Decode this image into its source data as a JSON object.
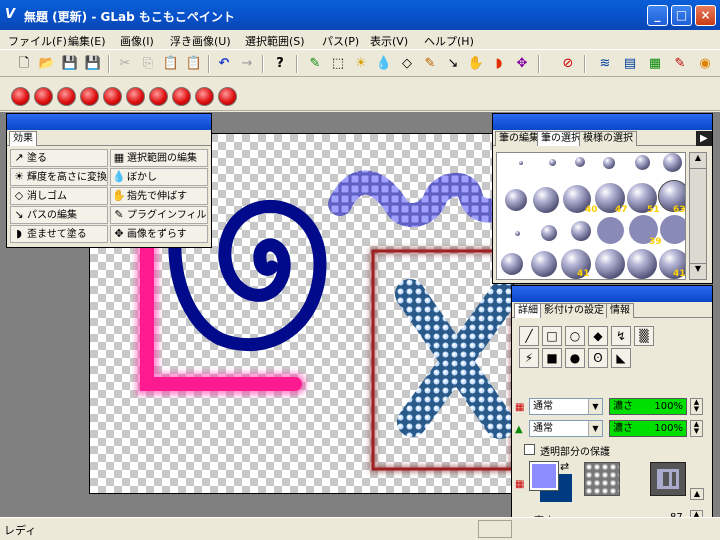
{
  "window": {
    "title": "無題 (更新) - GLab もこもこペイント",
    "app_icon": "V",
    "min_label": "_",
    "max_label": "□",
    "close_label": "×"
  },
  "menu": [
    "ファイル(F)",
    "編集(E)",
    "画像(I)",
    "浮き画像(U)",
    "選択範囲(S)",
    "パス(P)",
    "表示(V)",
    "ヘルプ(H)"
  ],
  "toolbar1": {
    "help_label": "?"
  },
  "effects": {
    "tab": "効果",
    "items": [
      {
        "label": "塗る",
        "icon": "↗"
      },
      {
        "label": "選択範囲の編集",
        "icon": "▦"
      },
      {
        "label": "輝度を高さに変換",
        "icon": "☀"
      },
      {
        "label": "ぼかし",
        "icon": "💧"
      },
      {
        "label": "消しゴム",
        "icon": "◇"
      },
      {
        "label": "指先で伸ばす",
        "icon": "✋"
      },
      {
        "label": "パスの編集",
        "icon": "↘"
      },
      {
        "label": "プラグインフィルター",
        "icon": "✎"
      },
      {
        "label": "歪ませて塗る",
        "icon": "◗"
      },
      {
        "label": "画像をずらす",
        "icon": "✥"
      }
    ]
  },
  "brush_panel": {
    "tabs": [
      "筆の編集",
      "筆の選択",
      "模様の選択"
    ],
    "tab_arrow": "▶",
    "numbers": [
      "40",
      "47",
      "51",
      "63",
      "39",
      "41",
      "41"
    ]
  },
  "detail_panel": {
    "tabs": [
      "詳細",
      "影付けの設定",
      "情報"
    ],
    "blend1": {
      "mode": "通常",
      "param": "濃さ",
      "value": "100%"
    },
    "blend2": {
      "mode": "通常",
      "param": "濃さ",
      "value": "100%"
    },
    "checkbox_label": "透明部分の保護",
    "height_label": "高さ",
    "height_value": "87"
  },
  "colors": {
    "fg": "#8c8cff",
    "bg": "#003a80"
  },
  "status": {
    "text": "レディ"
  }
}
